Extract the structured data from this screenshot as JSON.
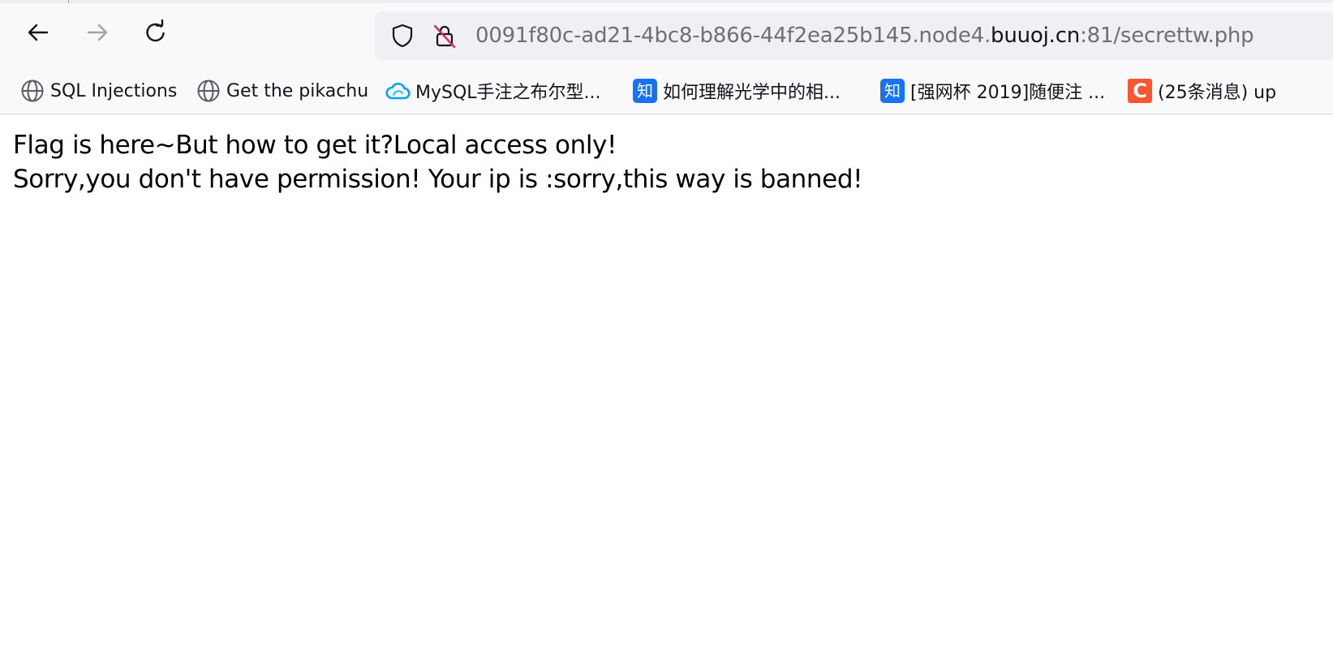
{
  "toolbar": {
    "back_icon": "arrow-left-icon",
    "forward_icon": "arrow-right-icon",
    "reload_icon": "reload-icon"
  },
  "urlbar": {
    "prefix": "0091f80c-ad21-4bc8-b866-44f2ea25b145.node4.",
    "host": "buuoj.cn",
    "suffix": ":81/secrettw.php",
    "tracking_icon": "shield-icon",
    "security_icon": "insecure-lock-icon"
  },
  "bookmarks": [
    {
      "label": "SQL Injections",
      "icon": "globe-icon"
    },
    {
      "label": "Get the pikachu",
      "icon": "globe-icon"
    },
    {
      "label": "MySQL手注之布尔型...",
      "icon": "cloud-icon"
    },
    {
      "label": "如何理解光学中的相...",
      "icon": "zhihu-icon",
      "icon_text": "知"
    },
    {
      "label": "[强网杯 2019]随便注 ...",
      "icon": "zhihu-icon",
      "icon_text": "知"
    },
    {
      "label": "(25条消息) up",
      "icon": "csdn-icon",
      "icon_text": "C"
    }
  ],
  "page": {
    "line1": "Flag is here~But how to get it?Local access only!",
    "line2": "Sorry,you don't have permission! Your ip is :sorry,this way is banned!"
  },
  "colors": {
    "zhihu": "#1772f6",
    "csdn": "#fc5531",
    "cloud": "#00a3ee"
  }
}
